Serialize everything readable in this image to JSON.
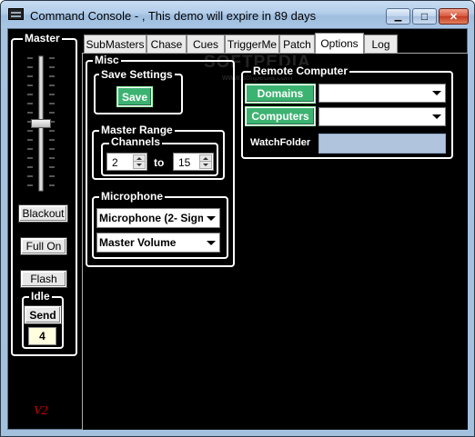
{
  "window": {
    "title": "Command Console - , This demo will expire in 89 days",
    "min_glyph": "▁",
    "max_glyph": "□",
    "close_glyph": "✕"
  },
  "master": {
    "label": "Master",
    "fader_level": 0.5,
    "blackout_label": "Blackout",
    "fullon_label": "Full On",
    "flash_label": "Flash"
  },
  "idle": {
    "label": "Idle",
    "send_label": "Send",
    "value": "4"
  },
  "version": "V2",
  "tabs": [
    "SubMasters",
    "Chase",
    "Cues",
    "TriggerMe",
    "Patch",
    "Options",
    "Log"
  ],
  "active_tab": "Options",
  "watermark": "SOFTPEDIA",
  "watermark_url": "www.softpedia.com",
  "misc": {
    "label": "Misc",
    "save_settings": {
      "label": "Save Settings",
      "save_button": "Save"
    },
    "master_range": {
      "label": "Master Range",
      "channels_label": "Channels",
      "from": "2",
      "to_label": "to",
      "to": "15"
    },
    "microphone": {
      "label": "Microphone",
      "device": "Microphone (2- Sigm",
      "mode": "Master Volume"
    }
  },
  "remote": {
    "label": "Remote Computer",
    "domains_button": "Domains",
    "computers_button": "Computers",
    "domains_value": "",
    "computers_value": "",
    "watchfolder_label": "WatchFolder",
    "watchfolder_value": ""
  },
  "colors": {
    "accent_green": "#3cb371",
    "idle_value_bg": "#ffffe0",
    "version_red": "#cc0000",
    "watchfolder_bg": "#b0c4de"
  }
}
